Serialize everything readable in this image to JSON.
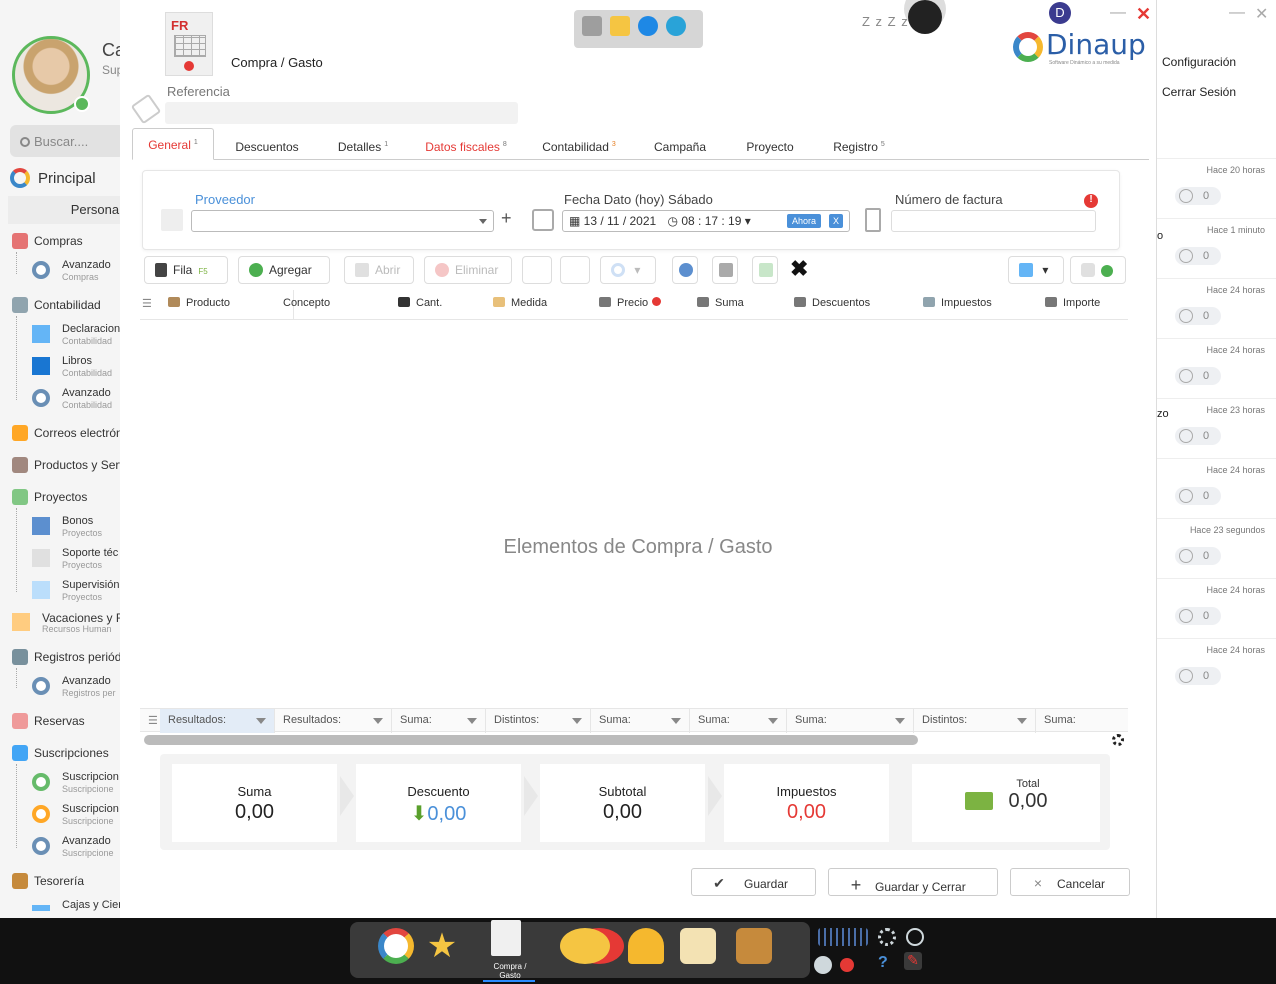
{
  "user": {
    "name": "Ca",
    "subtitle": "Sup"
  },
  "search": {
    "placeholder": "Buscar...."
  },
  "sidebar": {
    "principal": "Principal",
    "personal": "Personal",
    "items": [
      {
        "label": "Compras"
      },
      {
        "label": "Avanzado",
        "sub": "Compras"
      },
      {
        "label": "Contabilidad"
      },
      {
        "label": "Declaracion",
        "sub": "Contabilidad"
      },
      {
        "label": "Libros",
        "sub": "Contabilidad"
      },
      {
        "label": "Avanzado",
        "sub": "Contabilidad"
      },
      {
        "label": "Correos electrón"
      },
      {
        "label": "Productos y Serv"
      },
      {
        "label": "Proyectos"
      },
      {
        "label": "Bonos",
        "sub": "Proyectos"
      },
      {
        "label": "Soporte téc",
        "sub": "Proyectos"
      },
      {
        "label": "Supervisión",
        "sub": "Proyectos"
      },
      {
        "label": "Vacaciones y Fe",
        "sub": "Recursos Human"
      },
      {
        "label": "Registros periód"
      },
      {
        "label": "Avanzado",
        "sub": "Registros per"
      },
      {
        "label": "Reservas"
      },
      {
        "label": "Suscripciones"
      },
      {
        "label": "Suscripcion",
        "sub": "Suscripcione"
      },
      {
        "label": "Suscripcion",
        "sub": "Suscripcione"
      },
      {
        "label": "Avanzado",
        "sub": "Suscripcione"
      },
      {
        "label": "Tesorería"
      },
      {
        "label": "Cajas y Cier"
      }
    ]
  },
  "window": {
    "title": "Compra / Gasto",
    "ref_label": "Referencia",
    "doc_badge": "FR"
  },
  "status": {
    "zzz": "Z z Z z",
    "user_initial": "D"
  },
  "brand": {
    "name": "Dinaup",
    "tagline": "Software Dinámico a su medida"
  },
  "tabs": [
    {
      "label": "General",
      "badge": "1"
    },
    {
      "label": "Descuentos",
      "badge": ""
    },
    {
      "label": "Detalles",
      "badge": "1"
    },
    {
      "label": "Datos fiscales",
      "badge": "8"
    },
    {
      "label": "Contabilidad",
      "badge": "3"
    },
    {
      "label": "Campaña",
      "badge": ""
    },
    {
      "label": "Proyecto",
      "badge": ""
    },
    {
      "label": "Registro",
      "badge": "5"
    }
  ],
  "form": {
    "proveedor_label": "Proveedor",
    "proveedor_value": "",
    "fecha_label": "Fecha Dato (hoy) Sábado",
    "fecha_value": "13 / 11 /  2021",
    "hora_value": "08 : 17 : 19",
    "ahora": "Ahora",
    "clear": "X",
    "factura_label": "Número de factura",
    "factura_value": "",
    "alert": "!"
  },
  "actions": {
    "fila": "Fila",
    "fila_key": "F5",
    "agregar": "Agregar",
    "abrir": "Abrir",
    "eliminar": "Eliminar"
  },
  "columns": [
    "Producto",
    "Concepto",
    "Cant.",
    "Medida",
    "Precio",
    "Suma",
    "Descuentos",
    "Impuestos",
    "Importe"
  ],
  "empty_message": "Elementos de Compra / Gasto",
  "summary_row": [
    "Resultados:",
    "Resultados:",
    "Suma:",
    "Distintos:",
    "Suma:",
    "Suma:",
    "Suma:",
    "Distintos:",
    "Suma:"
  ],
  "totals": [
    {
      "label": "Suma",
      "value": "0,00"
    },
    {
      "label": "Descuento",
      "value": "0,00"
    },
    {
      "label": "Subtotal",
      "value": "0,00"
    },
    {
      "label": "Impuestos",
      "value": "0,00"
    },
    {
      "label": "Total",
      "value": "0,00"
    }
  ],
  "buttons": {
    "guardar": "Guardar",
    "guardar_cerrar": "Guardar y Cerrar",
    "cancelar": "Cancelar"
  },
  "right_panel": {
    "configuracion": "Configuración",
    "cerrar_sesion": "Cerrar Sesión",
    "items": [
      {
        "time": "Hace 20 horas",
        "count": "0"
      },
      {
        "time": "Hace 1 minuto",
        "count": "0"
      },
      {
        "time": "Hace 24 horas",
        "count": "0"
      },
      {
        "time": "Hace 24 horas",
        "count": "0"
      },
      {
        "time": "Hace 23 horas",
        "count": "0"
      },
      {
        "time": "Hace 24 horas",
        "count": "0"
      },
      {
        "time": "Hace 23 segundos",
        "count": "0"
      },
      {
        "time": "Hace 24 horas",
        "count": "0"
      },
      {
        "time": "Hace 24 horas",
        "count": "0"
      }
    ],
    "frag1": "o",
    "frag2": "zo"
  },
  "taskbar": {
    "active_label": "Compra / Gasto"
  },
  "colors": {
    "accent_red": "#e53935",
    "accent_blue": "#4a90d9",
    "brand_blue": "#2b5ea7",
    "ok_green": "#5cb85c"
  }
}
